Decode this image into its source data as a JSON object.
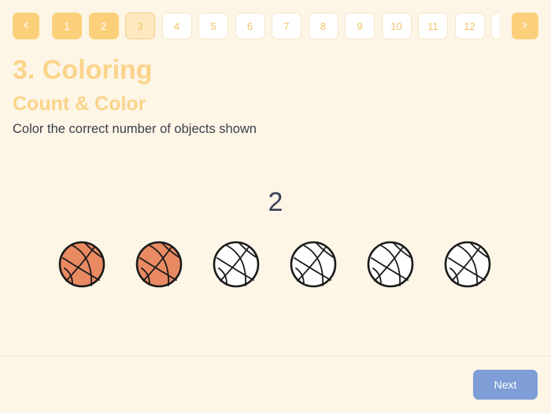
{
  "nav": {
    "prev_icon": "chevron-left-icon",
    "next_icon": "chevron-right-icon",
    "prev_glyph": "‹",
    "next_glyph": "›"
  },
  "pages": [
    {
      "label": "1",
      "state": "done"
    },
    {
      "label": "2",
      "state": "done"
    },
    {
      "label": "3",
      "state": "current"
    },
    {
      "label": "4",
      "state": "todo"
    },
    {
      "label": "5",
      "state": "todo"
    },
    {
      "label": "6",
      "state": "todo"
    },
    {
      "label": "7",
      "state": "todo"
    },
    {
      "label": "8",
      "state": "todo"
    },
    {
      "label": "9",
      "state": "todo"
    },
    {
      "label": "10",
      "state": "todo"
    },
    {
      "label": "11",
      "state": "todo"
    },
    {
      "label": "12",
      "state": "todo"
    },
    {
      "label": "",
      "state": "todo"
    }
  ],
  "lesson": {
    "title": "3. Coloring",
    "subtitle": "Count & Color",
    "instruction": "Color the correct number of objects shown"
  },
  "exercise": {
    "target_count": "2",
    "object_icon": "basketball-icon",
    "balls": [
      {
        "colored": true
      },
      {
        "colored": true
      },
      {
        "colored": false
      },
      {
        "colored": false
      },
      {
        "colored": false
      },
      {
        "colored": false
      }
    ]
  },
  "footer": {
    "next_label": "Next"
  },
  "colors": {
    "accent": "#fcd07b",
    "ball_fill": "#e98a63",
    "next_button": "#7f9dd6",
    "background": "#fdf5e6"
  }
}
